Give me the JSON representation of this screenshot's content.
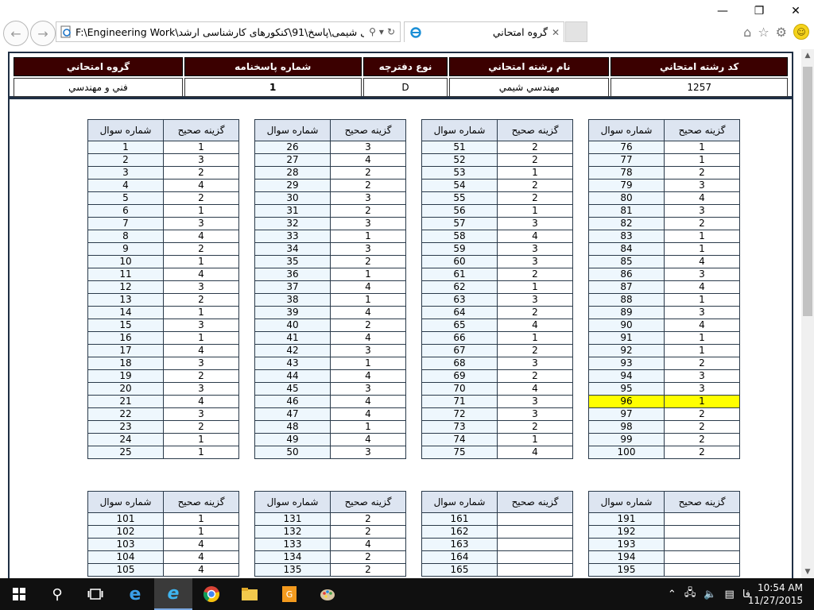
{
  "window": {
    "minimize": "—",
    "restore": "❐",
    "close": "✕"
  },
  "address_bar": {
    "url": "F:\\Engineering Work\\مهندسی شیمی\\پاسخ\\91\\کنکورهای کارشناسی ارشد",
    "search_glyph": "⚲",
    "dropdown_glyph": "▾",
    "refresh_glyph": "↻"
  },
  "tab": {
    "title": "گروه امتحاني",
    "close": "✕"
  },
  "header": {
    "columns": [
      "کد رشته امتحاني",
      "نام رشته امتحاني",
      "نوع دفترچه",
      "شماره پاسخنامه",
      "گروه امتحاني"
    ],
    "values": [
      "1257",
      "مهندسي شيمي",
      "D",
      "1",
      "فني و مهندسي"
    ]
  },
  "answer_headers": {
    "question": "شماره سوال",
    "answer": "گزينه صحيح"
  },
  "block1": {
    "columns": [
      {
        "q": [
          "1",
          "2",
          "3",
          "4",
          "5",
          "6",
          "7",
          "8",
          "9",
          "10",
          "11",
          "12",
          "13",
          "14",
          "15",
          "16",
          "17",
          "18",
          "19",
          "20",
          "21",
          "22",
          "23",
          "24",
          "25"
        ],
        "a": [
          "1",
          "3",
          "2",
          "4",
          "2",
          "1",
          "3",
          "4",
          "2",
          "1",
          "4",
          "3",
          "2",
          "1",
          "3",
          "1",
          "4",
          "3",
          "2",
          "3",
          "4",
          "3",
          "2",
          "1",
          "1"
        ]
      },
      {
        "q": [
          "26",
          "27",
          "28",
          "29",
          "30",
          "31",
          "32",
          "33",
          "34",
          "35",
          "36",
          "37",
          "38",
          "39",
          "40",
          "41",
          "42",
          "43",
          "44",
          "45",
          "46",
          "47",
          "48",
          "49",
          "50"
        ],
        "a": [
          "3",
          "4",
          "2",
          "2",
          "3",
          "2",
          "3",
          "1",
          "3",
          "2",
          "1",
          "4",
          "1",
          "4",
          "2",
          "4",
          "3",
          "1",
          "4",
          "3",
          "4",
          "4",
          "1",
          "4",
          "3"
        ]
      },
      {
        "q": [
          "51",
          "52",
          "53",
          "54",
          "55",
          "56",
          "57",
          "58",
          "59",
          "60",
          "61",
          "62",
          "63",
          "64",
          "65",
          "66",
          "67",
          "68",
          "69",
          "70",
          "71",
          "72",
          "73",
          "74",
          "75"
        ],
        "a": [
          "2",
          "2",
          "1",
          "2",
          "2",
          "1",
          "3",
          "4",
          "3",
          "3",
          "2",
          "1",
          "3",
          "2",
          "4",
          "1",
          "2",
          "3",
          "2",
          "4",
          "3",
          "3",
          "2",
          "1",
          "4"
        ]
      },
      {
        "q": [
          "76",
          "77",
          "78",
          "79",
          "80",
          "81",
          "82",
          "83",
          "84",
          "85",
          "86",
          "87",
          "88",
          "89",
          "90",
          "91",
          "92",
          "93",
          "94",
          "95",
          "96",
          "97",
          "98",
          "99",
          "100"
        ],
        "a": [
          "1",
          "1",
          "2",
          "3",
          "4",
          "3",
          "2",
          "1",
          "1",
          "4",
          "3",
          "4",
          "1",
          "3",
          "4",
          "1",
          "1",
          "2",
          "3",
          "3",
          "1",
          "2",
          "2",
          "2",
          "2"
        ]
      }
    ],
    "highlight_question": "96"
  },
  "block2": {
    "columns": [
      {
        "q": [
          "101",
          "102",
          "103",
          "104",
          "105"
        ],
        "a": [
          "1",
          "1",
          "4",
          "4",
          "4"
        ]
      },
      {
        "q": [
          "131",
          "132",
          "133",
          "134",
          "135"
        ],
        "a": [
          "2",
          "2",
          "4",
          "2",
          "2"
        ]
      },
      {
        "q": [
          "161",
          "162",
          "163",
          "164",
          "165"
        ],
        "a": [
          "",
          "",
          "",
          "",
          ""
        ]
      },
      {
        "q": [
          "191",
          "192",
          "193",
          "194",
          "195"
        ],
        "a": [
          "",
          "",
          "",
          "",
          ""
        ]
      }
    ]
  },
  "taskbar": {
    "time": "10:54 AM",
    "date": "11/27/2015",
    "language": "فا"
  },
  "colors": {
    "header_bg": "#3b0000",
    "question_cell_bg": "#eef7fd",
    "highlight": "#ffff00",
    "taskbar_bg": "#101010"
  }
}
